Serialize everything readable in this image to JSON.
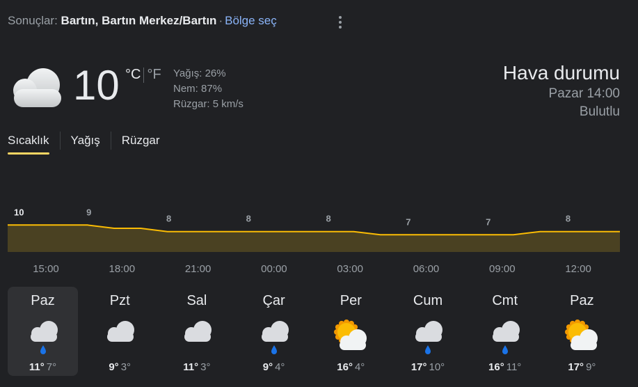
{
  "results": {
    "prefix": "Sonuçlar: ",
    "location": "Bartın, Bartın Merkez/Bartın",
    "separator": "·",
    "region_link": "Bölge seç"
  },
  "current": {
    "icon": "cloudy-icon",
    "temperature": "10",
    "unit_c": "°C",
    "unit_f": "°F",
    "precipitation": "Yağış: 26%",
    "humidity": "Nem: 87%",
    "wind": "Rüzgar: 5 km/s"
  },
  "summary": {
    "title": "Hava durumu",
    "time": "Pazar 14:00",
    "condition": "Bulutlu"
  },
  "tabs": [
    {
      "label": "Sıcaklık",
      "active": true
    },
    {
      "label": "Yağış",
      "active": false
    },
    {
      "label": "Rüzgar",
      "active": false
    }
  ],
  "chart_data": {
    "type": "area",
    "x": [
      "14:00",
      "15:00",
      "16:00",
      "17:00",
      "18:00",
      "19:00",
      "20:00",
      "21:00",
      "22:00",
      "23:00",
      "00:00",
      "01:00",
      "02:00",
      "03:00",
      "04:00",
      "05:00",
      "06:00",
      "07:00",
      "08:00",
      "09:00",
      "10:00",
      "11:00",
      "12:00",
      "13:00"
    ],
    "values": [
      10,
      10,
      10,
      10,
      9,
      9,
      8,
      8,
      8,
      8,
      8,
      8,
      8,
      8,
      7,
      7,
      7,
      7,
      7,
      7,
      8,
      8,
      8,
      8
    ],
    "data_labels": [
      "10",
      "9",
      "8",
      "8",
      "8",
      "7",
      "7",
      "8"
    ],
    "x_tick_labels": [
      "15:00",
      "18:00",
      "21:00",
      "00:00",
      "03:00",
      "06:00",
      "09:00",
      "12:00"
    ],
    "line_color": "#fbbc04",
    "fill_color": "#4a4122"
  },
  "days": [
    {
      "name": "Paz",
      "icon": "cloud-rain-icon",
      "high": "11°",
      "low": "7°",
      "selected": true
    },
    {
      "name": "Pzt",
      "icon": "cloudy-icon",
      "high": "9°",
      "low": "3°",
      "selected": false
    },
    {
      "name": "Sal",
      "icon": "cloudy-icon",
      "high": "11°",
      "low": "3°",
      "selected": false
    },
    {
      "name": "Çar",
      "icon": "cloud-rain-icon",
      "high": "9°",
      "low": "4°",
      "selected": false
    },
    {
      "name": "Per",
      "icon": "partly-cloudy-icon",
      "high": "16°",
      "low": "4°",
      "selected": false
    },
    {
      "name": "Cum",
      "icon": "cloud-rain-icon",
      "high": "17°",
      "low": "10°",
      "selected": false
    },
    {
      "name": "Cmt",
      "icon": "cloud-rain-icon",
      "high": "16°",
      "low": "11°",
      "selected": false
    },
    {
      "name": "Paz",
      "icon": "partly-cloudy-icon",
      "high": "17°",
      "low": "9°",
      "selected": false
    }
  ]
}
